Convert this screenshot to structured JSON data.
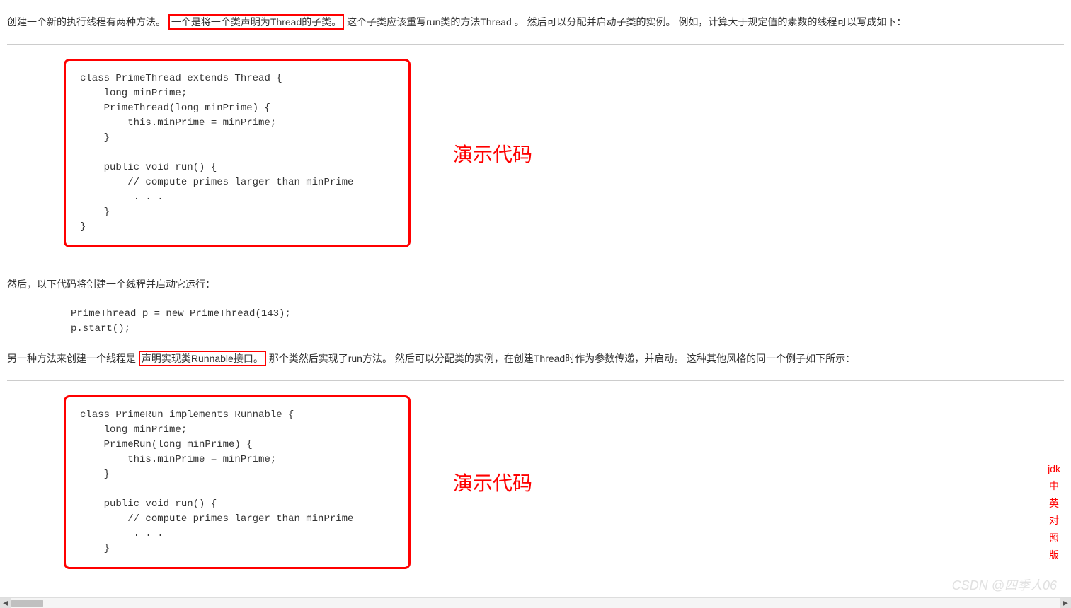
{
  "para1": {
    "before": "创建一个新的执行线程有两种方法。",
    "highlight": "一个是将一个类声明为Thread的子类。",
    "after": " 这个子类应该重写run类的方法Thread 。 然后可以分配并启动子类的实例。 例如，计算大于规定值的素数的线程可以写成如下："
  },
  "code1": "class PrimeThread extends Thread {\n    long minPrime;\n    PrimeThread(long minPrime) {\n        this.minPrime = minPrime;\n    }\n\n    public void run() {\n        // compute primes larger than minPrime\n         . . .\n    }\n}",
  "demo_label": "演示代码",
  "para2": "然后，以下代码将创建一个线程并启动它运行：",
  "code2": "PrimeThread p = new PrimeThread(143);\np.start();",
  "para3": {
    "before": "另一种方法来创建一个线程是",
    "highlight": "声明实现类Runnable接口。",
    "after": " 那个类然后实现了run方法。 然后可以分配类的实例，在创建Thread时作为参数传递，并启动。 这种其他风格的同一个例子如下所示："
  },
  "code3": "class PrimeRun implements Runnable {\n    long minPrime;\n    PrimeRun(long minPrime) {\n        this.minPrime = minPrime;\n    }\n\n    public void run() {\n        // compute primes larger than minPrime\n         . . .\n    }",
  "side": [
    "jdk",
    "中",
    "英",
    "对",
    "照",
    "版"
  ],
  "watermark": "CSDN @四季人06"
}
